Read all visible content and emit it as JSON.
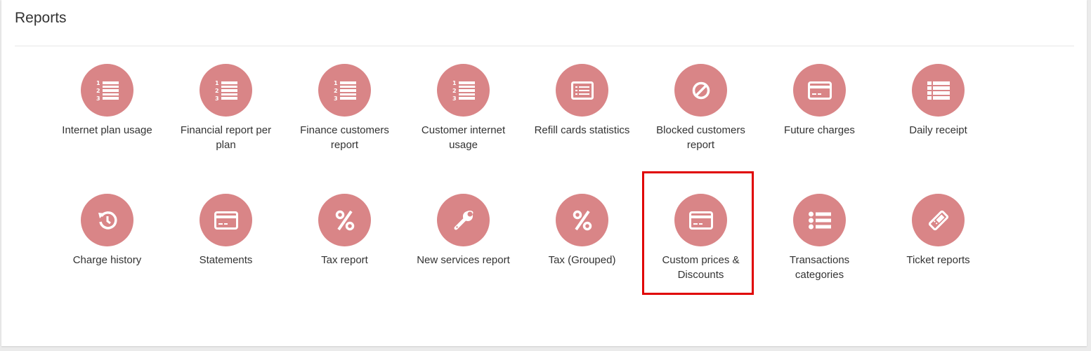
{
  "page": {
    "title": "Reports"
  },
  "accent_color": "#d98587",
  "highlight_color": "#e00000",
  "reports": [
    {
      "label": "Internet plan usage",
      "icon": "numbered-list-icon"
    },
    {
      "label": "Financial report per plan",
      "icon": "numbered-list-icon"
    },
    {
      "label": "Finance customers report",
      "icon": "numbered-list-icon"
    },
    {
      "label": "Customer internet usage",
      "icon": "numbered-list-icon"
    },
    {
      "label": "Refill cards statistics",
      "icon": "card-list-icon"
    },
    {
      "label": "Blocked customers report",
      "icon": "ban-icon"
    },
    {
      "label": "Future charges",
      "icon": "credit-card-icon"
    },
    {
      "label": "Daily receipt",
      "icon": "list-icon"
    },
    {
      "label": "Charge history",
      "icon": "history-icon"
    },
    {
      "label": "Statements",
      "icon": "credit-card-icon"
    },
    {
      "label": "Tax report",
      "icon": "percent-icon"
    },
    {
      "label": "New services report",
      "icon": "wrench-icon"
    },
    {
      "label": "Tax (Grouped)",
      "icon": "percent-icon"
    },
    {
      "label": "Custom prices & Discounts",
      "icon": "credit-card-icon"
    },
    {
      "label": "Transactions categories",
      "icon": "bulleted-list-icon"
    },
    {
      "label": "Ticket reports",
      "icon": "ticket-icon"
    }
  ]
}
